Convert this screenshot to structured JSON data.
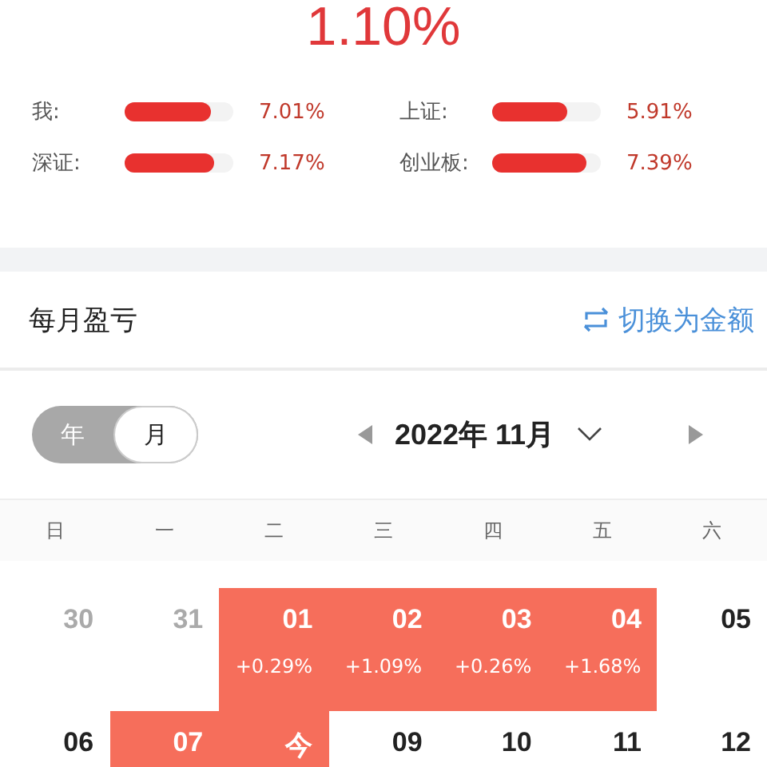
{
  "total_return": "1.10%",
  "comparisons": [
    {
      "label": "我:",
      "level": 0.8,
      "value": "7.01%"
    },
    {
      "label": "上证:",
      "level": 0.69,
      "value": "5.91%"
    },
    {
      "label": "深证:",
      "level": 0.82,
      "value": "7.17%"
    },
    {
      "label": "创业板:",
      "level": 0.87,
      "value": "7.39%"
    }
  ],
  "section": {
    "title": "每月盈亏",
    "switch_label": "切换为金额"
  },
  "period_toggle": [
    {
      "label": "年",
      "selected": false
    },
    {
      "label": "月",
      "selected": true
    }
  ],
  "month_label": "2022年 11月",
  "weekdays": [
    "日",
    "一",
    "二",
    "三",
    "四",
    "五",
    "六"
  ],
  "weeks": [
    [
      {
        "day": "30",
        "kind": "other"
      },
      {
        "day": "31",
        "kind": "other"
      },
      {
        "day": "01",
        "kind": "gain",
        "change": "+0.29%"
      },
      {
        "day": "02",
        "kind": "gain",
        "change": "+1.09%"
      },
      {
        "day": "03",
        "kind": "gain",
        "change": "+0.26%"
      },
      {
        "day": "04",
        "kind": "gain",
        "change": "+1.68%"
      },
      {
        "day": "05",
        "kind": "plain"
      }
    ],
    [
      {
        "day": "06",
        "kind": "plain"
      },
      {
        "day": "07",
        "kind": "gain"
      },
      {
        "day": "今",
        "kind": "gain"
      },
      {
        "day": "09",
        "kind": "plain"
      },
      {
        "day": "10",
        "kind": "plain"
      },
      {
        "day": "11",
        "kind": "plain"
      },
      {
        "day": "12",
        "kind": "plain"
      }
    ]
  ]
}
